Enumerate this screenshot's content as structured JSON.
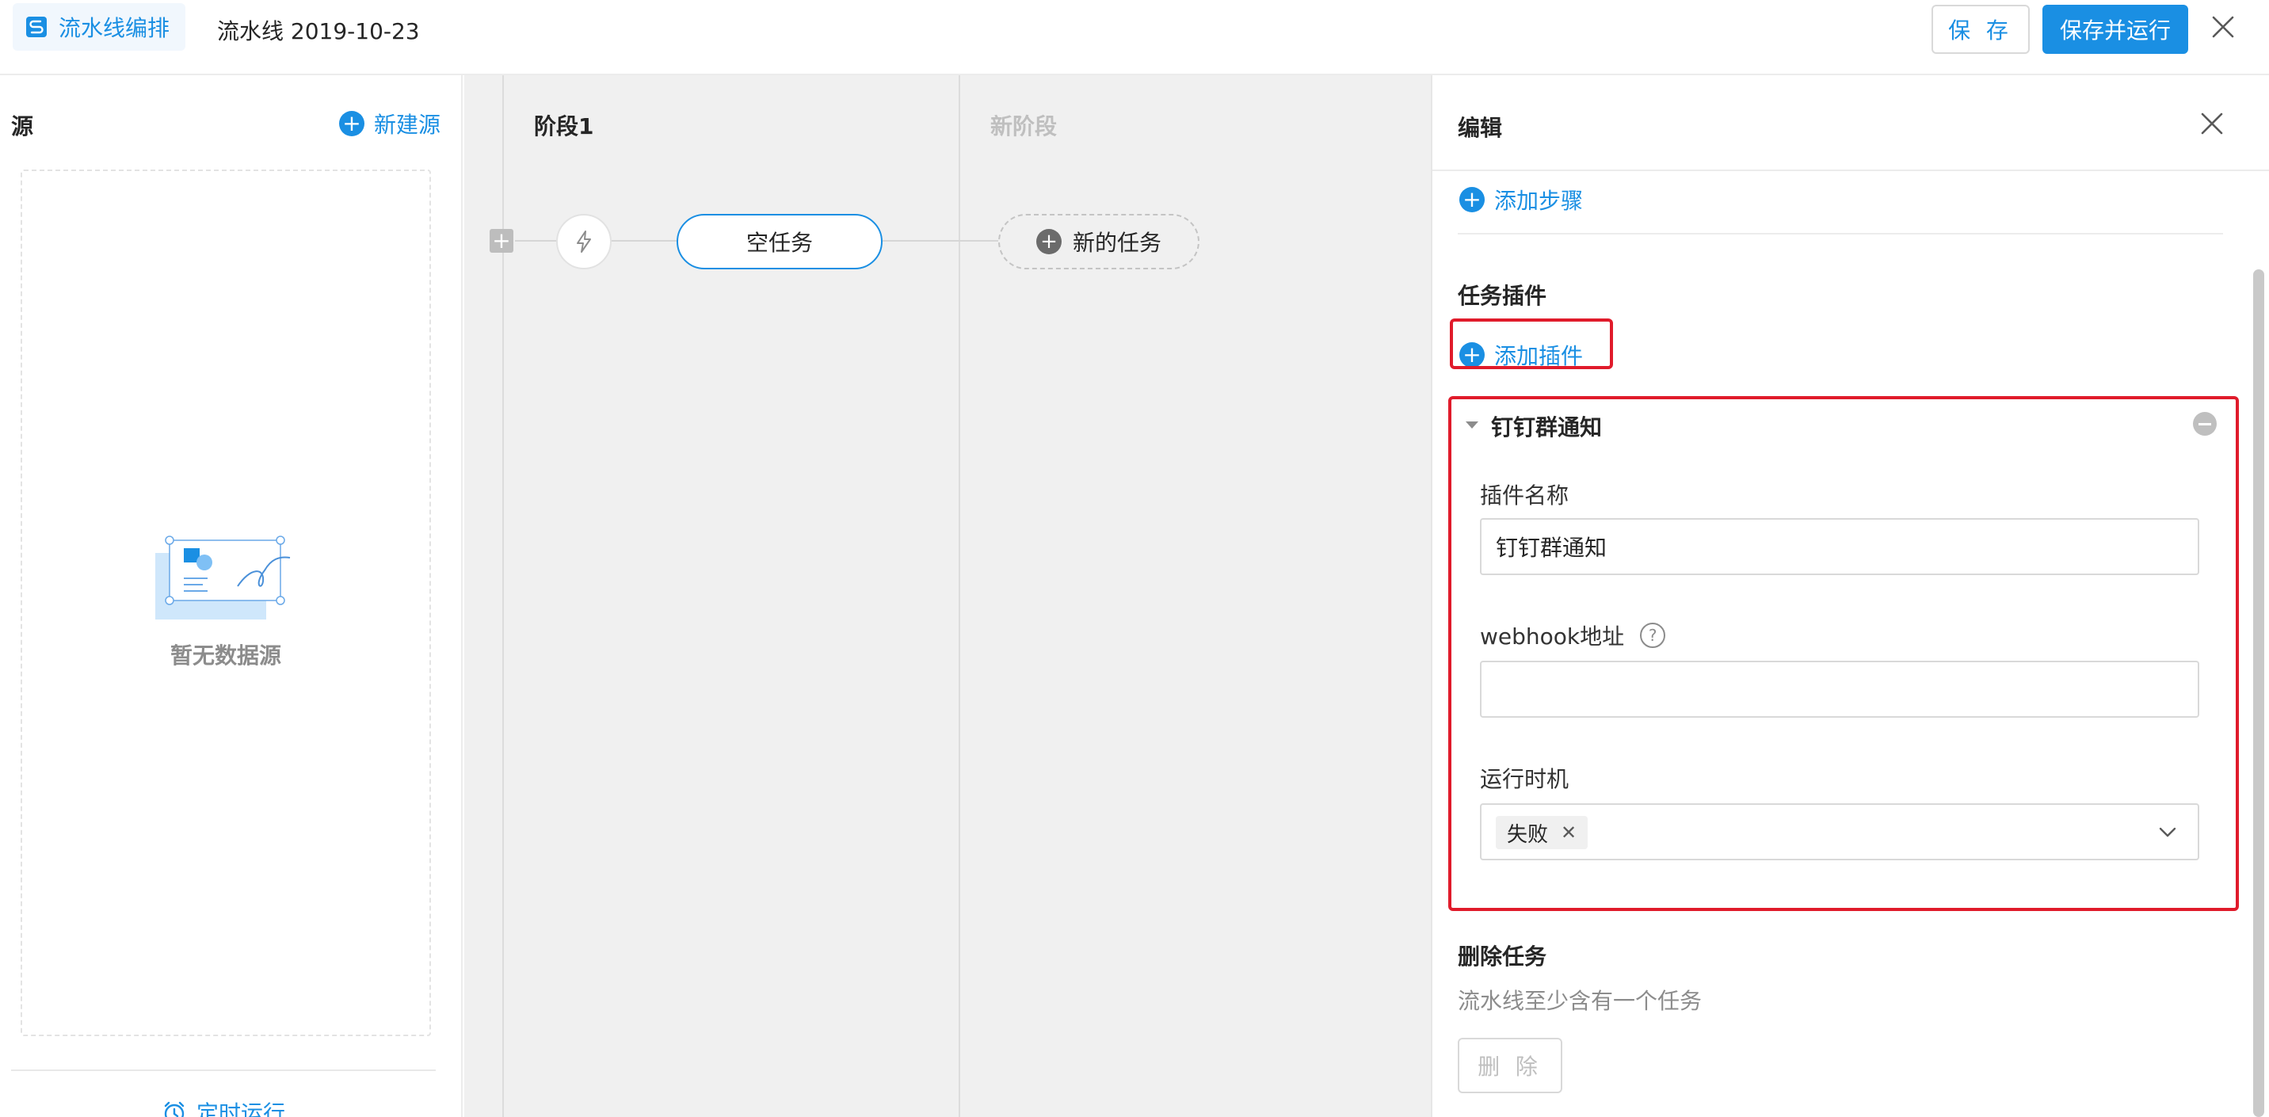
{
  "header": {
    "tab_label": "流水线编排",
    "pipeline_title": "流水线 2019-10-23",
    "save_label": "保 存",
    "save_run_label": "保存并运行"
  },
  "sources": {
    "title": "源",
    "new_source_label": "新建源",
    "empty_text": "暂无数据源",
    "schedule_label": "定时运行"
  },
  "canvas": {
    "stage1_label": "阶段1",
    "new_stage_label": "新阶段",
    "empty_task_label": "空任务",
    "new_task_label": "新的任务"
  },
  "editor": {
    "title": "编辑",
    "add_step_label": "添加步骤",
    "plugins_title": "任务插件",
    "add_plugin_label": "添加插件",
    "plugin": {
      "header": "钉钉群通知",
      "name_label": "插件名称",
      "name_value": "钉钉群通知",
      "webhook_label": "webhook地址",
      "webhook_value": "",
      "timing_label": "运行时机",
      "timing_tags": [
        "失败"
      ]
    },
    "delete_title": "删除任务",
    "delete_desc": "流水线至少含有一个任务",
    "delete_label": "删 除"
  },
  "colors": {
    "primary": "#1a8fe3",
    "highlight": "#e01b2b",
    "canvas_bg": "#f0f0f0"
  }
}
